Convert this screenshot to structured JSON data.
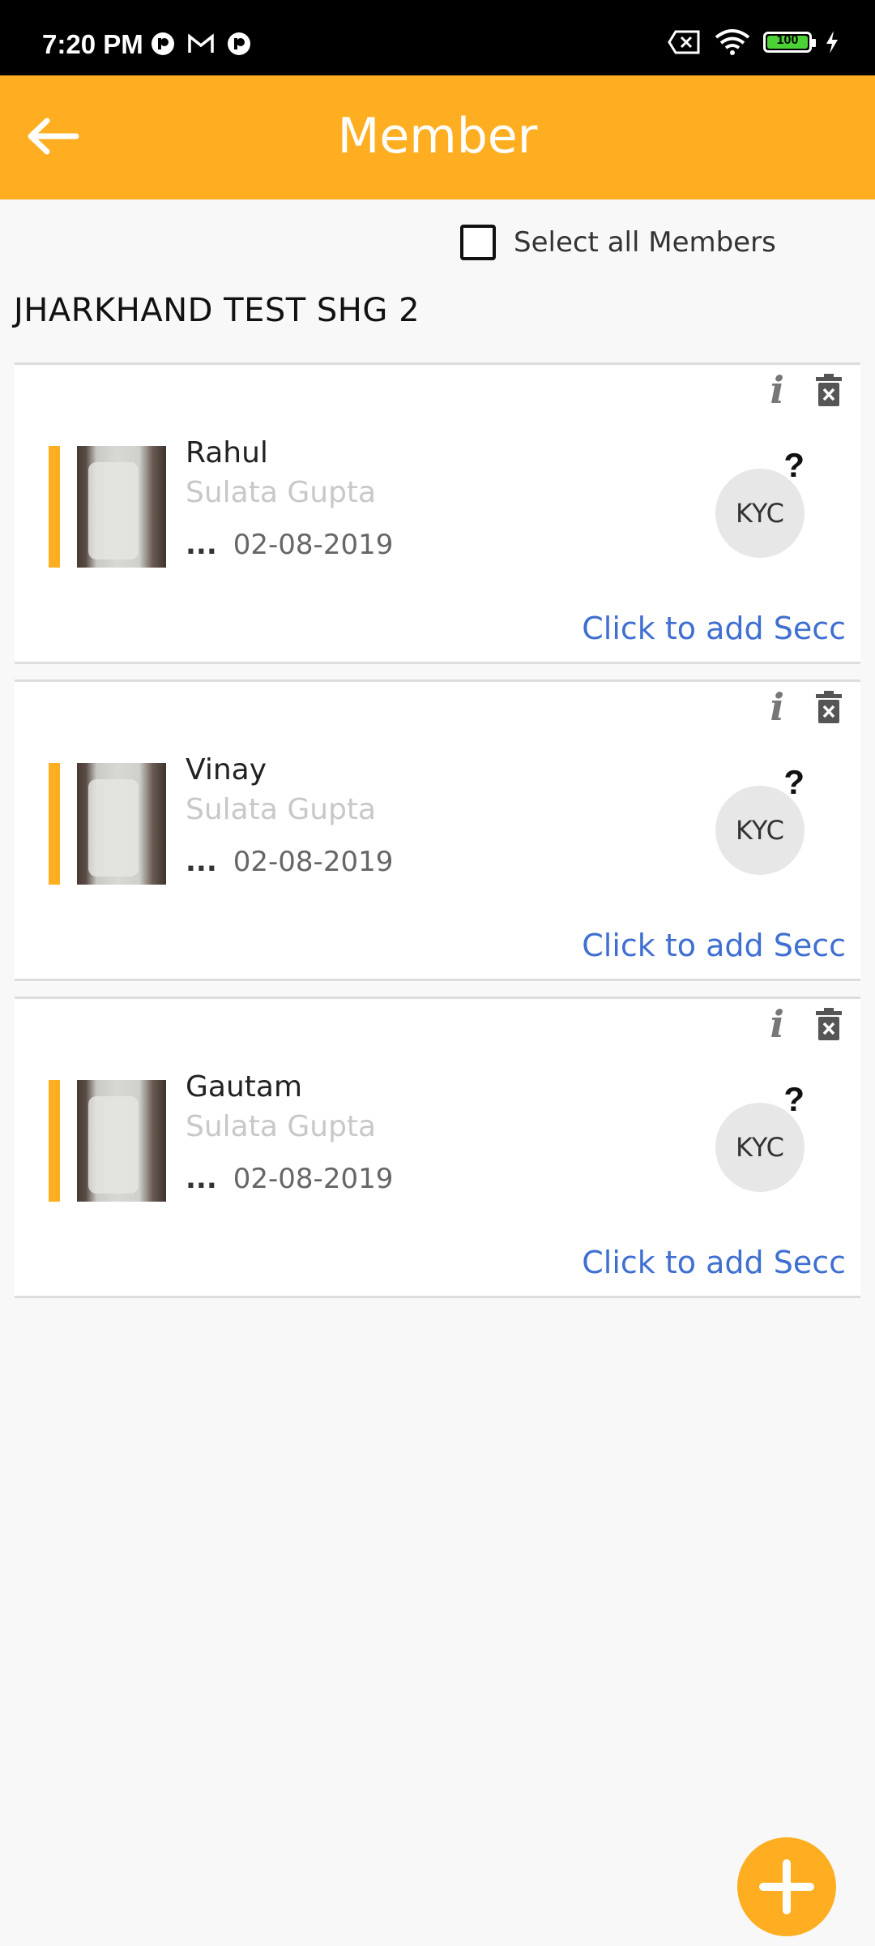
{
  "status_bar": {
    "time": "7:20 PM",
    "battery": "100"
  },
  "app_bar": {
    "title": "Member"
  },
  "select_all": {
    "label": "Select all Members"
  },
  "group": {
    "name": "JHARKHAND TEST SHG 2"
  },
  "members": [
    {
      "name": "Rahul",
      "subtitle": "Sulata Gupta",
      "dots": "...",
      "date": "02-08-2019",
      "kyc": "KYC",
      "kyc_mark": "?",
      "secc_link": "Click to add Secc"
    },
    {
      "name": "Vinay",
      "subtitle": "Sulata Gupta",
      "dots": "...",
      "date": "02-08-2019",
      "kyc": "KYC",
      "kyc_mark": "?",
      "secc_link": "Click to add Secc"
    },
    {
      "name": "Gautam",
      "subtitle": "Sulata Gupta",
      "dots": "...",
      "date": "02-08-2019",
      "kyc": "KYC",
      "kyc_mark": "?",
      "secc_link": "Click to add Secc"
    }
  ],
  "colors": {
    "accent": "#ffae21",
    "link": "#3f6fd1"
  },
  "icons": {
    "back": "arrow-left-icon",
    "info": "info-icon",
    "delete": "delete-icon",
    "add": "plus-icon"
  }
}
